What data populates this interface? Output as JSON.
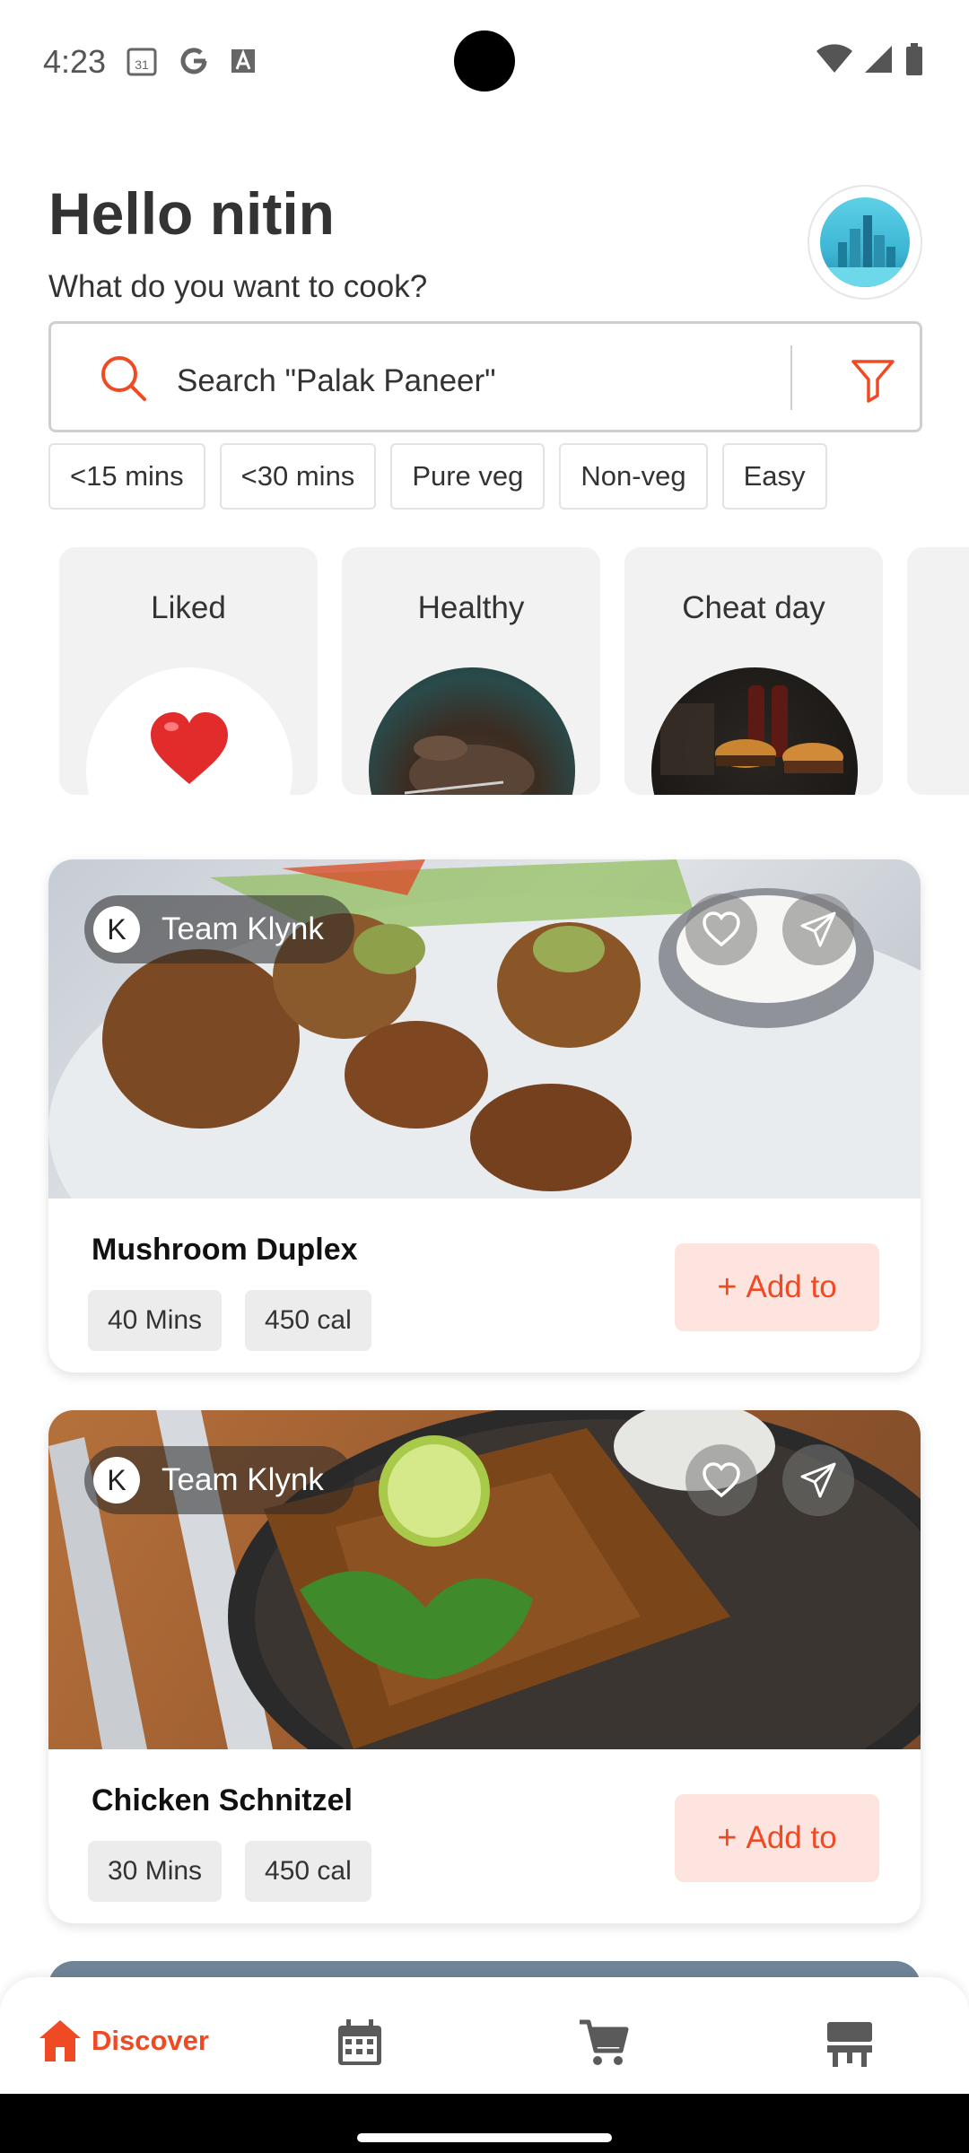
{
  "status_bar": {
    "time": "4:23",
    "calendar_day": "31"
  },
  "header": {
    "greeting": "Hello nitin",
    "subtitle": "What do you want to cook?"
  },
  "search": {
    "placeholder": "Search \"Palak Paneer\""
  },
  "filter_chips": [
    "<15 mins",
    "<30 mins",
    "Pure veg",
    "Non-veg",
    "Easy"
  ],
  "categories": [
    {
      "label": "Liked"
    },
    {
      "label": "Healthy"
    },
    {
      "label": "Cheat day"
    }
  ],
  "recipes": [
    {
      "author_initial": "K",
      "author": "Team Klynk",
      "title": "Mushroom Duplex",
      "time": "40 Mins",
      "calories": "450 cal",
      "add_label": "Add to"
    },
    {
      "author_initial": "K",
      "author": "Team Klynk",
      "title": "Chicken Schnitzel",
      "time": "30 Mins",
      "calories": "450 cal",
      "add_label": "Add to"
    }
  ],
  "bottom_nav": {
    "active": "Discover",
    "items": [
      "home-icon",
      "calendar-icon",
      "cart-icon",
      "pantry-icon"
    ]
  },
  "colors": {
    "accent": "#ef4a23",
    "accent_light": "#fde4de",
    "chip_border": "#e3e3e3"
  }
}
